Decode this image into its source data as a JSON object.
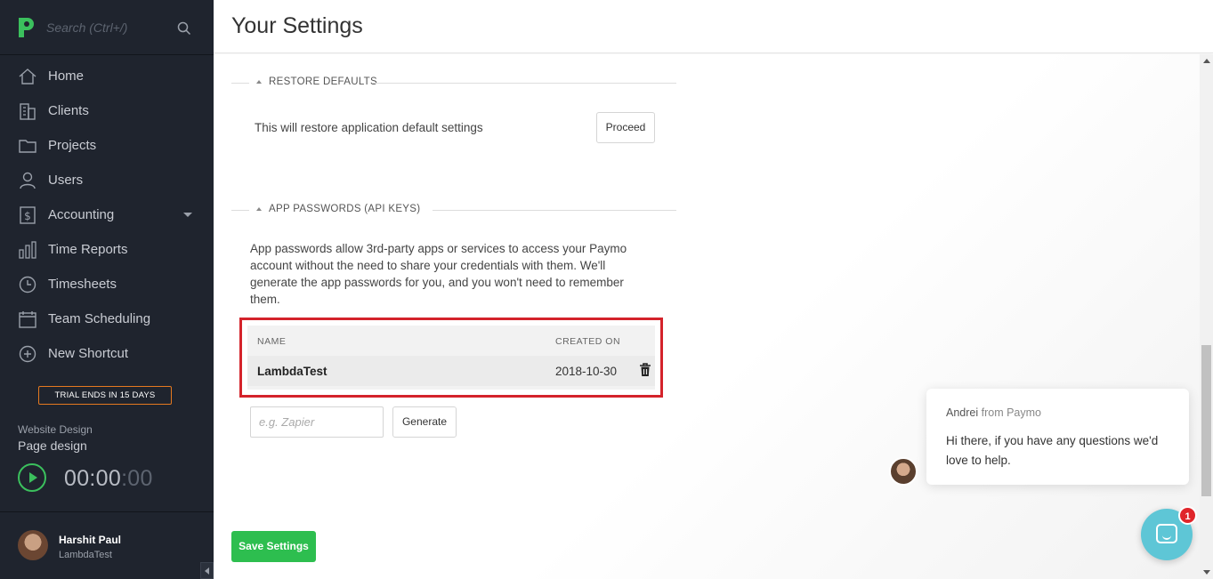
{
  "sidebar": {
    "search_placeholder": "Search (Ctrl+/)",
    "nav": [
      {
        "label": "Home",
        "icon": "home-icon"
      },
      {
        "label": "Clients",
        "icon": "building-icon"
      },
      {
        "label": "Projects",
        "icon": "folder-icon"
      },
      {
        "label": "Users",
        "icon": "user-icon"
      },
      {
        "label": "Accounting",
        "icon": "dollar-icon"
      },
      {
        "label": "Time Reports",
        "icon": "bar-chart-icon"
      },
      {
        "label": "Timesheets",
        "icon": "clock-icon"
      },
      {
        "label": "Team Scheduling",
        "icon": "calendar-icon"
      },
      {
        "label": "New Shortcut",
        "icon": "plus-circle-icon"
      }
    ],
    "trial": "TRIAL ENDS IN 15 DAYS",
    "project": "Website Design",
    "task": "Page design",
    "timer_main": "00:00",
    "timer_dim": ":00",
    "user_name": "Harshit Paul",
    "user_org": "LambdaTest"
  },
  "header": {
    "title": "Your Settings"
  },
  "restore": {
    "heading": "RESTORE DEFAULTS",
    "text": "This will restore application default settings",
    "button": "Proceed"
  },
  "api": {
    "heading": "APP PASSWORDS (API KEYS)",
    "description": "App passwords allow 3rd-party apps or services to access your Paymo account without the need to share your credentials with them. We'll generate the app passwords for you, and you won't need to remember them.",
    "columns": {
      "name": "NAME",
      "created": "CREATED ON"
    },
    "rows": [
      {
        "name": "LambdaTest",
        "created": "2018-10-30"
      }
    ],
    "input_placeholder": "e.g. Zapier",
    "generate_button": "Generate"
  },
  "save_button": "Save Settings",
  "chat": {
    "agent": "Andrei",
    "from_text": " from Paymo",
    "message": "Hi there, if you have any questions we'd love to help.",
    "badge_count": "1"
  },
  "colors": {
    "sidebar_bg": "#1f242e",
    "accent_green": "#2dbe4f",
    "highlight_red": "#d4232b",
    "trial_orange": "#e5791f",
    "chat_teal": "#5ec6d6"
  }
}
